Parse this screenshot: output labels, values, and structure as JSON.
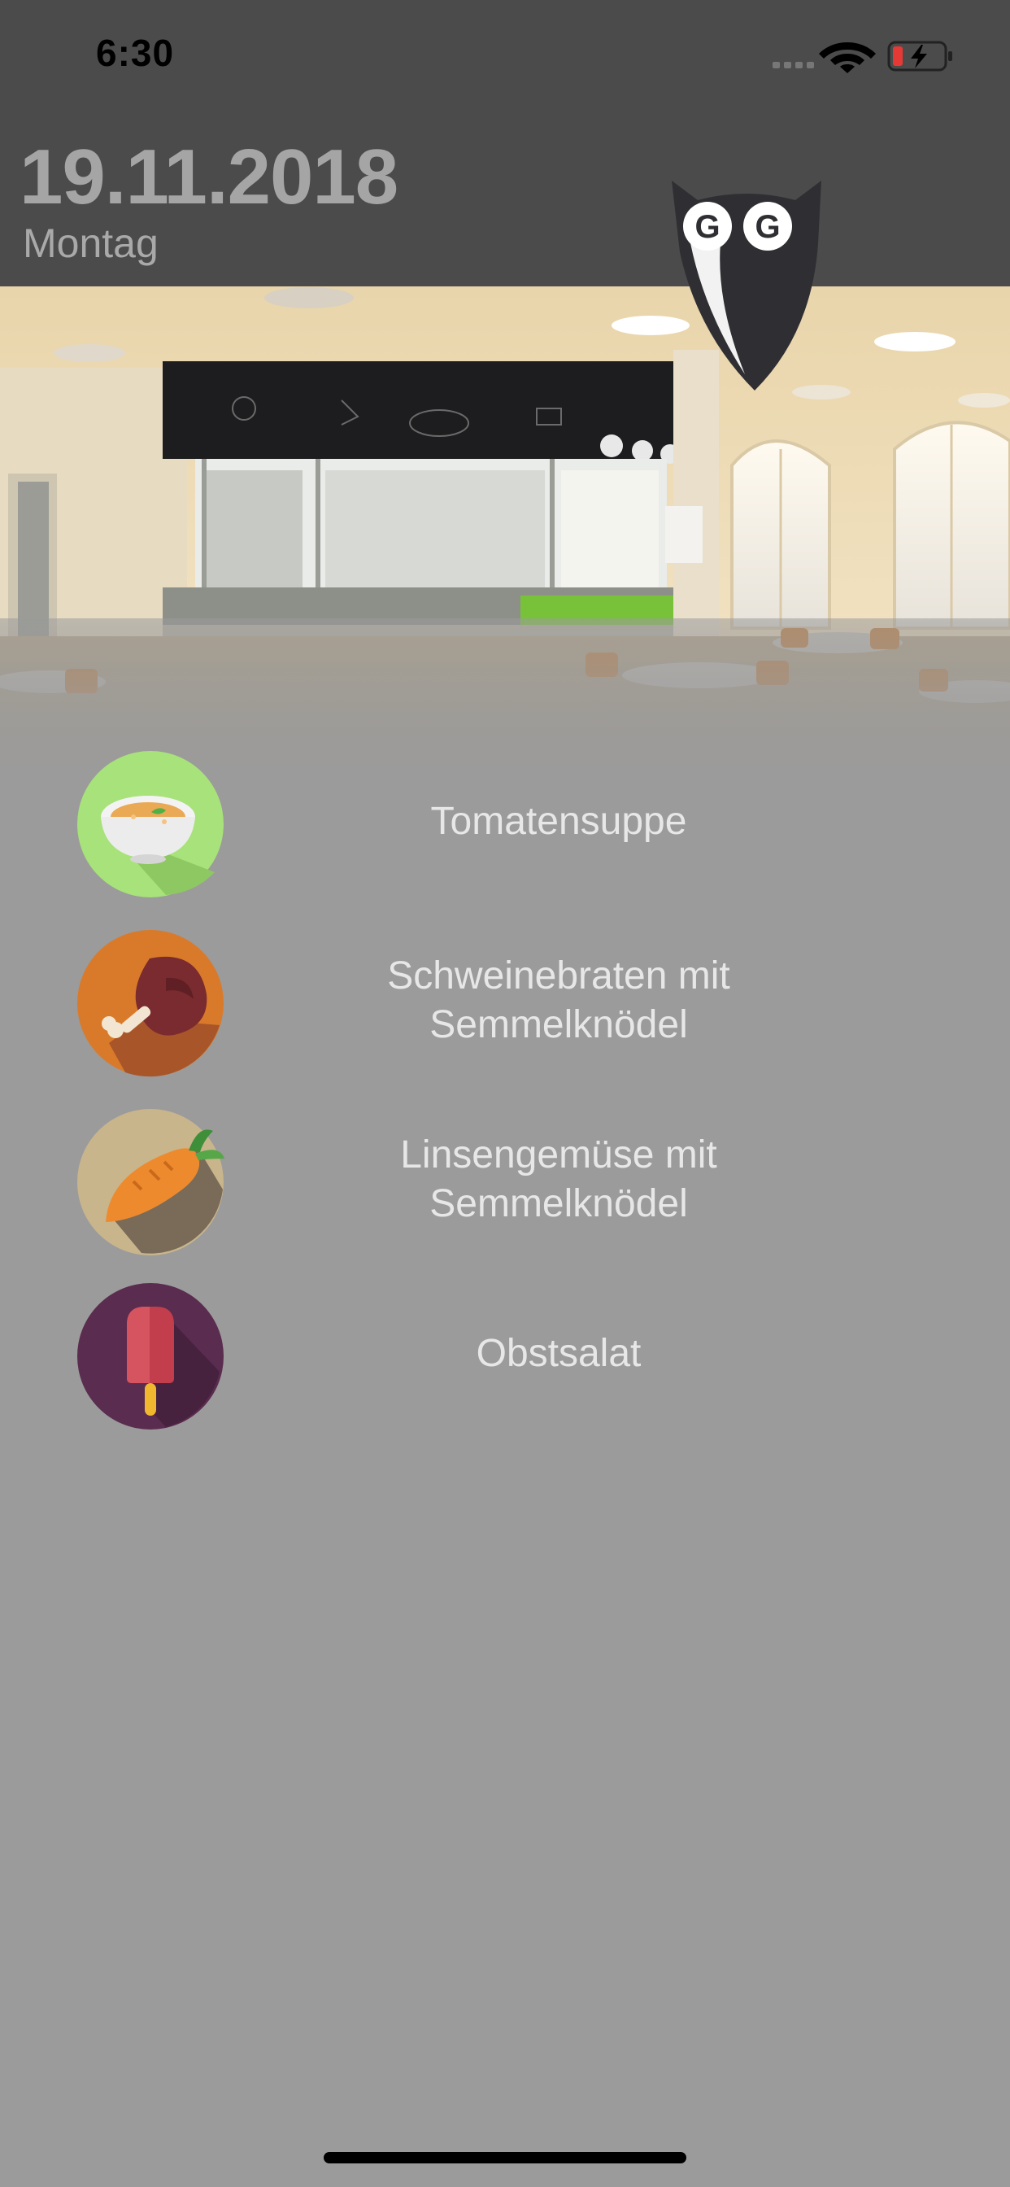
{
  "status_bar": {
    "time": "6:30",
    "icons": [
      "signal-icon",
      "wifi-icon",
      "battery-charging-icon"
    ]
  },
  "header": {
    "date": "19.11.2018",
    "weekday": "Montag"
  },
  "hero": {
    "logo_letters": "GG"
  },
  "menu": {
    "items": [
      {
        "label_line1": "Tomatensuppe",
        "label_line2": "",
        "icon": "soup-icon"
      },
      {
        "label_line1": "Schweinebraten mit",
        "label_line2": "Semmelknödel",
        "icon": "meat-icon"
      },
      {
        "label_line1": "Linsengemüse mit",
        "label_line2": "Semmelknödel",
        "icon": "carrot-icon"
      },
      {
        "label_line1": "Obstsalat",
        "label_line2": "",
        "icon": "popsicle-icon"
      }
    ]
  },
  "colors": {
    "header_bg": "#4b4b4b",
    "body_bg": "#9b9b9b",
    "soup_circle": "#a8e27a",
    "meat_circle": "#d97a2a",
    "carrot_circle": "#c8b58c",
    "popsicle_circle": "#5a2c4f"
  }
}
